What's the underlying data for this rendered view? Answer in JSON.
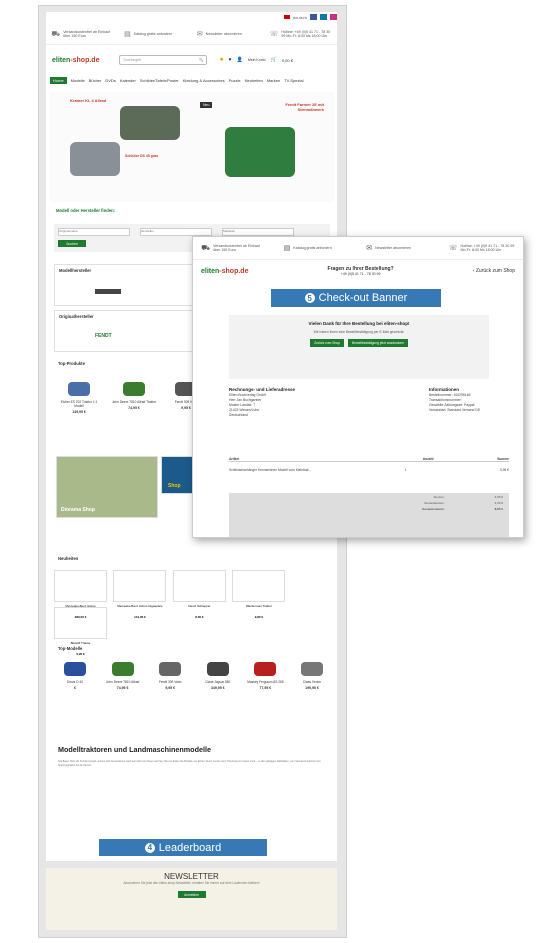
{
  "topbar": {
    "lang": "deutsch"
  },
  "service_bar": [
    {
      "icon": "truck-icon",
      "text": "Versandkostenfrei ab Einkauf über 150 Euro"
    },
    {
      "icon": "package-icon",
      "text": "Katalog gratis anfordern"
    },
    {
      "icon": "mail-icon",
      "text": "Newsletter abonnieren"
    },
    {
      "icon": "phone-icon",
      "text": "Hotline: +49 (0)5 41 71 - 78 30 99 Mo-Fr: 8:00 bis 18:00 Uhr"
    }
  ],
  "header": {
    "logo_a": "eliten",
    "logo_b": "-shop.de",
    "search_placeholder": "Suchbegriff",
    "account_label": "Mein Konto",
    "cart_label": "0,00 €"
  },
  "nav": [
    "Home",
    "Modelle",
    "Bücher",
    "DVDs",
    "Kalender",
    "Schilder/Tafeln/Poster",
    "Kleidung & Accessoires",
    "Puzzle",
    "Neuheiten",
    "Marken",
    "TV-Spezial"
  ],
  "hero": {
    "left_caption": "Schlüter DS 45 grau",
    "right_caption": "Fendt Farmer 2E mit Stirnmähwerk",
    "left_badge": "Neu",
    "right_brand": "Kramer KL 4 Allrad"
  },
  "search_section": {
    "title": "Modell oder Hersteller finden:",
    "button": "Suchen"
  },
  "filter_selects": [
    "Originalmarke",
    "Hersteller",
    "Maßstab"
  ],
  "sections": {
    "model_makers": "Modellhersteller",
    "original_makers": "Originalhersteller",
    "top_products": "Top-Produkte",
    "new_items": "Neuheiten",
    "top_models": "Top-Modelle"
  },
  "brands": {
    "original_1": "FENDT"
  },
  "top_products": [
    {
      "name": "Eicher ES 202 Traktor 1:1 Modell",
      "price": "149,95 €"
    },
    {
      "name": "John Deere 7810 Allrad Traktor",
      "price": "74,95 €"
    },
    {
      "name": "Fendt 309 Vario",
      "price": "9,95 €"
    }
  ],
  "banners": {
    "diorama": "Diorama Shop",
    "shop": "Shop"
  },
  "new_items": [
    {
      "name": "Mercedes-Benz Actros",
      "price": "289,00 €"
    },
    {
      "name": "Mercedes-Benz Actros Gigaspace",
      "price": "144,95 €"
    },
    {
      "name": "Deutz Schlepper",
      "price": "8,00 €"
    },
    {
      "name": "Wackerman Traktor",
      "price": "9,80 €"
    },
    {
      "name": "Bleistift Traktor",
      "price": "9,95 €"
    }
  ],
  "top_models": [
    {
      "name": "Deutz D 40",
      "price": "€"
    },
    {
      "name": "John Deere 7810 Allrad",
      "price": "74,95 €"
    },
    {
      "name": "Fendt 309 Vario",
      "price": "9,95 €"
    },
    {
      "name": "Claas Jaguar 850",
      "price": "349,95 €"
    },
    {
      "name": "Massey Ferguson 8S.265",
      "price": "77,95 €"
    },
    {
      "name": "Claas Xerion",
      "price": "199,95 €"
    }
  ],
  "article": {
    "title": "Modelltraktoren und Landmaschinenmodelle",
    "body": "Seit Bauer Hans die Scholle bestellt, sehnen sich Generationen nach dem Duft von Diesel und Heu. Bei uns finden Sie Modelle von Eicher, Deutz, Fendt, Lanz, Hanomag und vielen mehr – in allen gängigen Maßstäben, vom Sammlermodell bis zum Spielzeugtraktor für die Kleinen."
  },
  "labels": {
    "leaderboard_num": "4",
    "leaderboard": "Leaderboard",
    "checkout_num": "5",
    "checkout": "Check-out Banner"
  },
  "newsletter": {
    "title": "NEWSLETTER",
    "subtitle": "Abonnieren Sie jetzt den eliten-shop Newsletter, erhalten Sie immer auf dem Laufenden bleiben!",
    "button": "Anmelden"
  },
  "checkout": {
    "question": "Fragen zu Ihrer Bestellung?",
    "phone": "+49 (0)5 41 71 - 78 30 99",
    "back": "Zurück zum Shop",
    "thanks": "Vielen Dank für Ihre Bestellung bei eliten-shop!",
    "thanks_sub": "Wir haben Ihnen eine Bestellbestätigung per E-Mail geschickt.",
    "btn_shop": "Zurück zum Shop",
    "btn_print": "Bestellbestätigung jetzt ausdrucken",
    "billing_title": "Rechnungs- und Lieferadresse",
    "billing": [
      "Eliten Buchverlag GmbH",
      "Herr Jan Buchgartner",
      "Muster Landstr. 7",
      "21423 Winsen/Luhe",
      "Deutschland"
    ],
    "info_title": "Informationen",
    "info": [
      "Bestellnummer: 100295166",
      "Transaktionsnummer:",
      "Gewählte Zahlungsart: Paypal",
      "Versandart: Standard Versand DE"
    ],
    "table_head": [
      "Artikel",
      "Anzahl",
      "Summe"
    ],
    "item": "Schlüsselanhänger Kennzeichen Modell vom Kleintrak...",
    "item_qty": "1",
    "item_price": "3,95 €",
    "totals": [
      {
        "label": "Summe:",
        "value": "3,95 €"
      },
      {
        "label": "Versandkosten:",
        "value": "4,90 €"
      },
      {
        "label": "Gesamtsumme:",
        "value": "8,85 €"
      }
    ]
  }
}
